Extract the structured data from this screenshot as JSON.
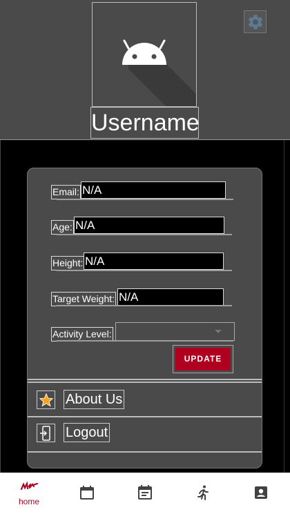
{
  "profile": {
    "username": "Username",
    "avatar_icon": "android-icon",
    "settings_icon": "gear-icon"
  },
  "form": {
    "email_label": "Email:",
    "email_value": "N/A",
    "age_label": "Age:",
    "age_value": "N/A",
    "height_label": "Height:",
    "height_value": "N/A",
    "target_weight_label": "Target Weight:",
    "target_weight_value": "N/A",
    "activity_label": "Activity Level:",
    "activity_value": "",
    "update_label": "UPDATE"
  },
  "menu": {
    "about_label": "About Us",
    "logout_label": "Logout"
  },
  "nav": {
    "home_label": "home",
    "items": [
      "home-icon",
      "calendar-icon",
      "event-note-icon",
      "running-icon",
      "contact-icon"
    ]
  },
  "colors": {
    "accent": "#b00020",
    "panel": "#4a4a4a",
    "background": "#000000"
  }
}
